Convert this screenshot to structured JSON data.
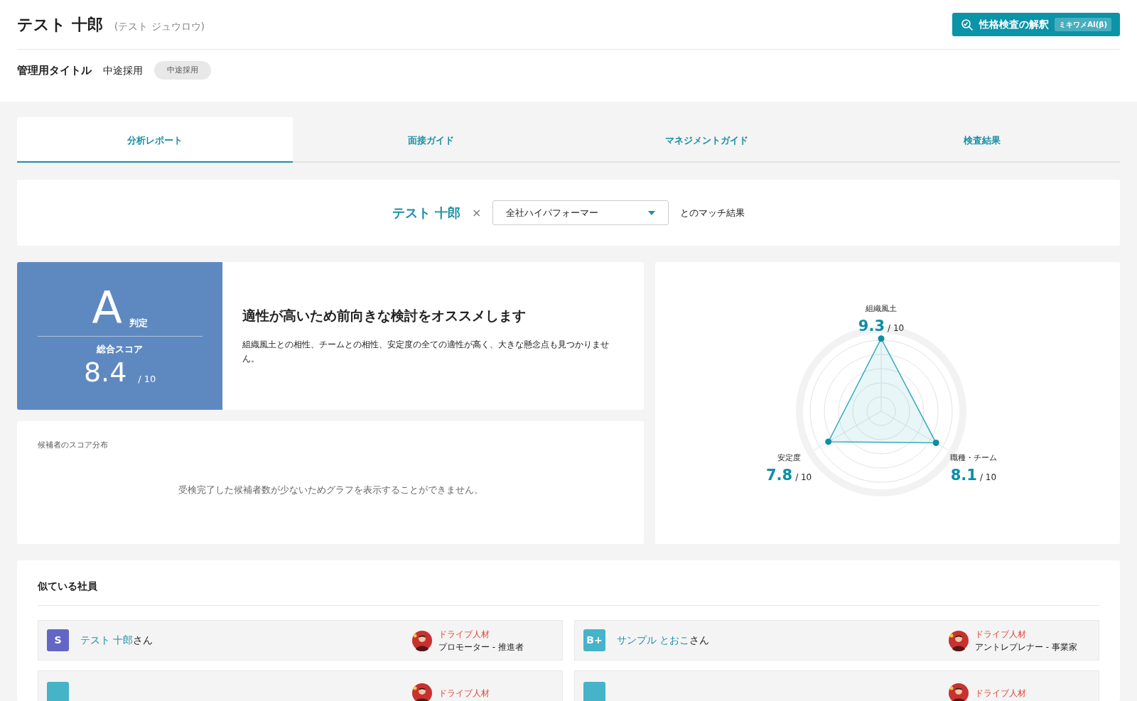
{
  "header": {
    "name": "テスト 十郎",
    "kana": "(テスト ジュウロウ)",
    "ai_button": {
      "label": "性格検査の解釈",
      "badge": "ミキワメAI(β)"
    },
    "title_label": "管理用タイトル",
    "title_value": "中途採用",
    "tag": "中途採用"
  },
  "tabs": [
    {
      "label": "分析レポート",
      "selected": true
    },
    {
      "label": "面接ガイド",
      "selected": false
    },
    {
      "label": "マネジメントガイド",
      "selected": false
    },
    {
      "label": "検査結果",
      "selected": false
    }
  ],
  "match": {
    "name": "テスト 十郎",
    "times": "×",
    "select_value": "全社ハイパフォーマー",
    "suffix": "とのマッチ結果"
  },
  "verdict": {
    "grade": "A",
    "grade_label": "判定",
    "score_label": "総合スコア",
    "score": "8.4",
    "score_max": "/ 10",
    "headline": "適性が高いため前向きな検討をオススメします",
    "description": "組織風土との相性、チームとの相性、安定度の全ての適性が高く、大きな懸念点も見つかりません。"
  },
  "distribution": {
    "title": "候補者のスコア分布",
    "message": "受検完了した候補者数が少ないためグラフを表示することができません。"
  },
  "radar": {
    "axes": [
      {
        "label": "組織風土",
        "score": "9.3",
        "max": "/ 10"
      },
      {
        "label": "安定度",
        "score": "7.8",
        "max": "/ 10"
      },
      {
        "label": "職種・チーム",
        "score": "8.1",
        "max": "/ 10"
      }
    ]
  },
  "similar": {
    "title": "似ている社員",
    "people": [
      {
        "badge": "S",
        "color": "#6266c4",
        "name": "テスト 十郎",
        "suffix": "さん",
        "type": "ドライブ人材",
        "role": "プロモーター - 推進者"
      },
      {
        "badge": "B+",
        "color": "#45b3c8",
        "name": "サンプル とおこ",
        "suffix": "さん",
        "type": "ドライブ人材",
        "role": "アントレプレナー - 事業家"
      },
      {
        "color": "#45b3c8",
        "type": "ドライブ人材"
      },
      {
        "color": "#45b3c8",
        "type": "ドライブ人材"
      }
    ]
  }
}
